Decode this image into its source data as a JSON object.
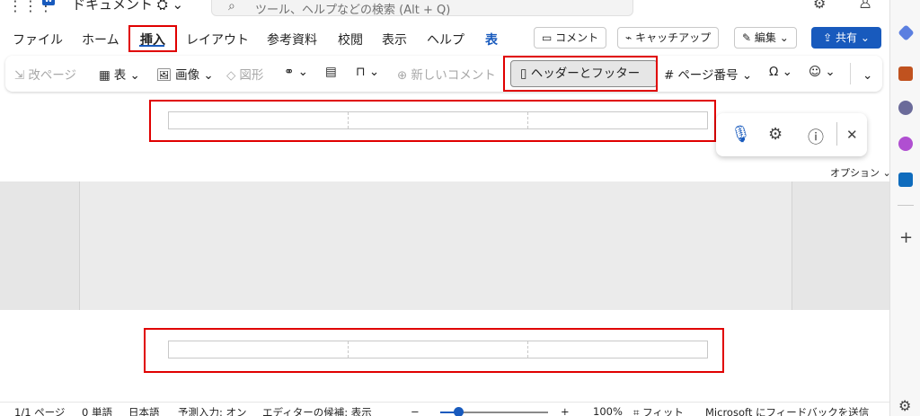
{
  "titlebar": {
    "doc_title": "ドキュメント",
    "search_placeholder": "ツール、ヘルプなどの検索 (Alt + Q)"
  },
  "tabs": [
    {
      "label": "ファイル"
    },
    {
      "label": "ホーム"
    },
    {
      "label": "挿入",
      "active": true
    },
    {
      "label": "レイアウト"
    },
    {
      "label": "参考資料"
    },
    {
      "label": "校閲"
    },
    {
      "label": "表示"
    },
    {
      "label": "ヘルプ"
    },
    {
      "label": "表"
    }
  ],
  "header_actions": {
    "comment": "コメント",
    "catchup": "キャッチアップ",
    "edit": "編集",
    "share": "共有"
  },
  "ribbon": {
    "page_break": "改ページ",
    "table": "表",
    "image": "画像",
    "shapes": "図形",
    "new_comment": "新しいコメント",
    "header_footer": "ヘッダーとフッター",
    "page_number": "ページ番号"
  },
  "dictation": {
    "options": "オプション"
  },
  "statusbar": {
    "page": "1/1 ページ",
    "words": "0 単語",
    "language": "日本語",
    "predictive": "予測入力: オン",
    "editor": "エディターの候補: 表示",
    "zoom_minus": "−",
    "zoom_plus": "+",
    "zoom_level": "100%",
    "zoom_value": 0.17,
    "fit": "フィット",
    "feedback": "Microsoft にフィードバックを送信"
  },
  "colors": {
    "accent": "#185abd",
    "highlight": "#e00000"
  }
}
